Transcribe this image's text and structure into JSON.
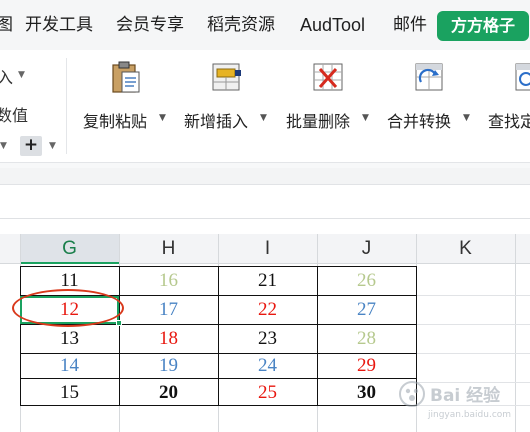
{
  "menu": {
    "items": [
      "图",
      "开发工具",
      "会员专享",
      "稻壳资源",
      "AudTool",
      "邮件"
    ],
    "highlight": "方方格子",
    "highlight_color": "#1aa260"
  },
  "ribbon": {
    "left_fragment_top": "入",
    "left_fragment_mid": "数值",
    "plus_symbol": "+",
    "tools": [
      {
        "label": "复制粘贴",
        "icon": "clipboard-paste-icon"
      },
      {
        "label": "新增插入",
        "icon": "insert-row-icon"
      },
      {
        "label": "批量删除",
        "icon": "delete-grid-icon"
      },
      {
        "label": "合并转换",
        "icon": "merge-convert-icon"
      },
      {
        "label": "查找定",
        "icon": "find-icon"
      }
    ]
  },
  "sheet": {
    "active_column": "G",
    "column_headers": [
      "G",
      "H",
      "I",
      "J",
      "K"
    ],
    "rows": [
      [
        {
          "v": "11",
          "c": "black"
        },
        {
          "v": "16",
          "c": "olive"
        },
        {
          "v": "21",
          "c": "black"
        },
        {
          "v": "26",
          "c": "olive"
        }
      ],
      [
        {
          "v": "12",
          "c": "red"
        },
        {
          "v": "17",
          "c": "blue"
        },
        {
          "v": "22",
          "c": "red"
        },
        {
          "v": "27",
          "c": "blue"
        }
      ],
      [
        {
          "v": "13",
          "c": "black"
        },
        {
          "v": "18",
          "c": "red"
        },
        {
          "v": "23",
          "c": "black"
        },
        {
          "v": "28",
          "c": "olive"
        }
      ],
      [
        {
          "v": "14",
          "c": "blue"
        },
        {
          "v": "19",
          "c": "blue"
        },
        {
          "v": "24",
          "c": "blue"
        },
        {
          "v": "29",
          "c": "red"
        }
      ],
      [
        {
          "v": "15",
          "c": "black"
        },
        {
          "v": "20",
          "c": "black"
        },
        {
          "v": "25",
          "c": "red"
        },
        {
          "v": "30",
          "c": "black"
        }
      ]
    ],
    "colors": {
      "black": "#111111",
      "red": "#e8170f",
      "blue": "#4a84c4",
      "olive": "#b6c98e",
      "annotation": "#d9391c"
    }
  },
  "watermark": {
    "text": "Bai 经验",
    "subtext": "jingyan.baidu.com"
  }
}
